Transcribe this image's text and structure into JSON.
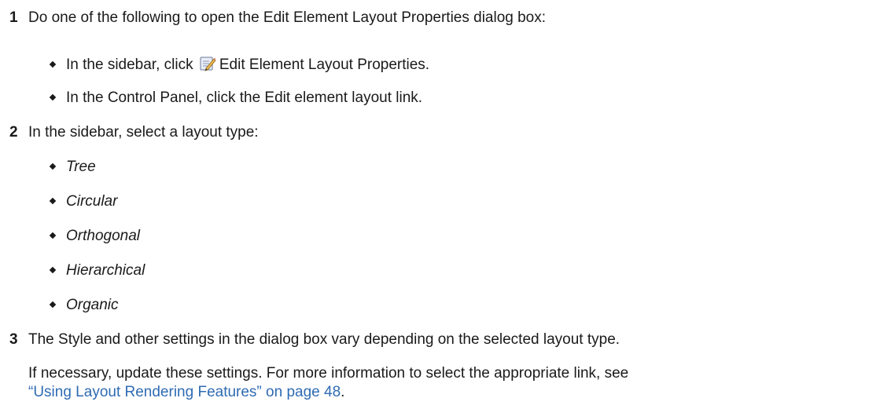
{
  "steps": [
    {
      "num": "1",
      "text": "Do one of the following to open the Edit Element Layout Properties dialog box:",
      "bullets": [
        {
          "before": "In the sidebar, click",
          "icon": "edit-layout-properties-icon",
          "after": "Edit Element Layout Properties."
        },
        {
          "text": "In the Control Panel, click the Edit element layout link."
        }
      ]
    },
    {
      "num": "2",
      "text": "In the sidebar, select a layout type:",
      "bullets": [
        "Tree",
        "Circular",
        "Orthogonal",
        "Hierarchical",
        "Organic"
      ]
    },
    {
      "num": "3",
      "text": "The Style and other settings in the dialog box vary depending on the selected layout type.",
      "para1": "If necessary, update these settings. For more information to select the appropriate link, see",
      "link": "“Using Layout Rendering Features” on page 48",
      "link_after": "."
    }
  ]
}
